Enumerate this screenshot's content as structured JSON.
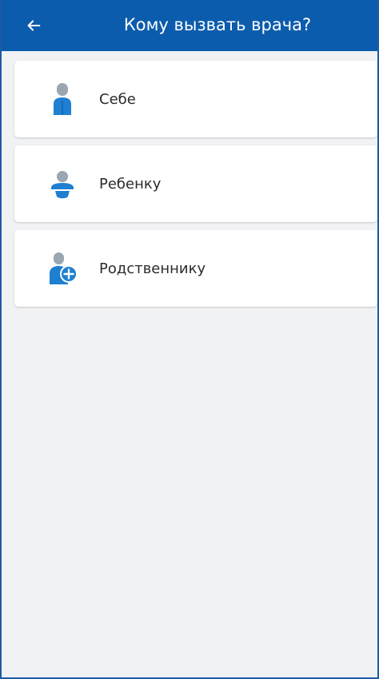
{
  "header": {
    "back_icon": "arrow-left-icon",
    "title": "Кому вызвать врача?"
  },
  "options": [
    {
      "label": "Себе",
      "icon": "adult-person-icon"
    },
    {
      "label": "Ребенку",
      "icon": "child-person-icon"
    },
    {
      "label": "Родственнику",
      "icon": "add-relative-icon"
    }
  ],
  "colors": {
    "header": "#0c5cad",
    "accent_blue": "#1f7fd1",
    "icon_gray": "#9aa6b2",
    "background": "#f1f2f4",
    "card": "#ffffff"
  }
}
